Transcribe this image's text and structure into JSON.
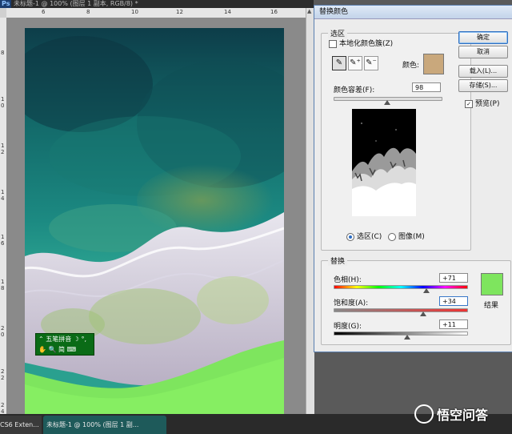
{
  "document": {
    "title": "未标题-1 @ 100% (图层 1 副本, RGB/8) *",
    "ruler_top_ticks": [
      "6",
      "8",
      "10",
      "12",
      "14",
      "16"
    ],
    "ruler_left_ticks": [
      "8",
      "1 0",
      "1 2",
      "1 4",
      "1 6",
      "1 8",
      "2 0",
      "2 2",
      "2 4"
    ]
  },
  "ime_toolbar": {
    "row1": "⌃ 五笔拼音  ☽ °,",
    "row2": "✋ 🔍 简 ⌨"
  },
  "taskbar": {
    "tab1": "CS6 Exten...",
    "tab2": "未标题-1 @ 100% (图层 1 副..."
  },
  "watermark": "悟空问答",
  "dialog": {
    "title": "替换颜色",
    "selection_group": "选区",
    "localized_clusters_label": "本地化颜色簇(Z)",
    "localized_clusters_checked": false,
    "color_label": "颜色:",
    "selection_color": "#c9a87c",
    "fuzziness_label": "颜色容差(F):",
    "fuzziness_value": "98",
    "fuzziness_fraction": 0.49,
    "radio_selection": "选区(C)",
    "radio_image": "图像(M)",
    "replace_group": "替换",
    "hue_label": "色相(H):",
    "hue_value": "+71",
    "hue_fraction": 0.69,
    "saturation_label": "饱和度(A):",
    "saturation_value": "+34",
    "saturation_fraction": 0.67,
    "lightness_label": "明度(G):",
    "lightness_value": "+11",
    "lightness_fraction": 0.55,
    "result_label": "结果",
    "result_color": "#7ee55e",
    "ok_button": "确定",
    "cancel_button": "取消",
    "load_button": "载入(L)...",
    "save_button": "存储(S)...",
    "preview_label": "预览(P)",
    "preview_checked": true
  }
}
